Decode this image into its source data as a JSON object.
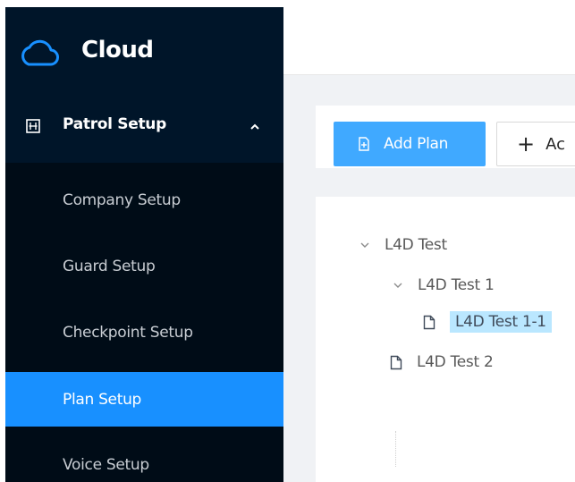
{
  "app": {
    "logo_icon": "cloud-icon",
    "logo_text": "Cloud"
  },
  "sidebar": {
    "parent": {
      "label": "Patrol Setup",
      "icon": "grid-icon",
      "caret_icon": "caret-up-icon",
      "expanded": true
    },
    "items": [
      {
        "label": "Company Setup",
        "active": false
      },
      {
        "label": "Guard Setup",
        "active": false
      },
      {
        "label": "Checkpoint Setup",
        "active": false
      },
      {
        "label": "Plan Setup",
        "active": true
      },
      {
        "label": "Voice Setup",
        "active": false
      }
    ]
  },
  "toolbar": {
    "add_plan_label": "Add Plan",
    "add_plan_icon": "file-add-icon",
    "second_label": "Ac",
    "second_icon": "plus-icon"
  },
  "tree": {
    "root": {
      "label": "L4D Test",
      "expanded": true
    },
    "child1": {
      "label": "L4D Test 1",
      "expanded": true
    },
    "leaf1": {
      "label": "L4D Test 1-1",
      "selected": true
    },
    "child2": {
      "label": "L4D Test 2"
    }
  },
  "colors": {
    "sidebar_bg": "#001529",
    "submenu_bg": "#000c17",
    "accent": "#1890ff",
    "primary_button": "#40a9ff",
    "selected_node_bg": "#bae7ff",
    "content_bg": "#f0f2f5"
  }
}
